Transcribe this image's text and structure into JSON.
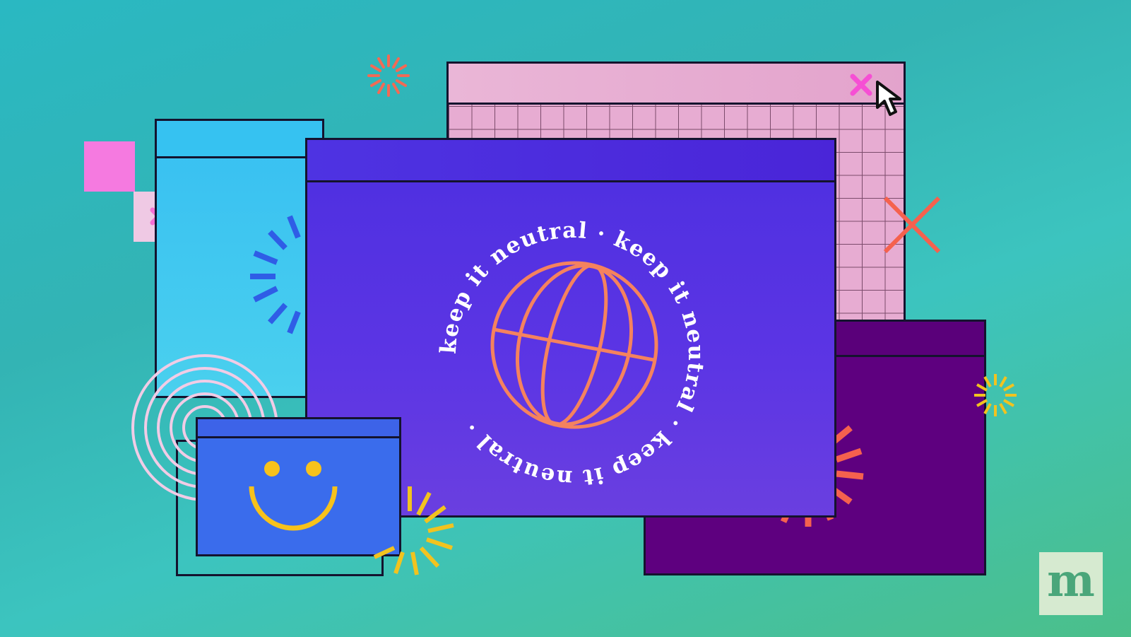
{
  "illustration": {
    "circular_text": "keep it neutral · keep it neutral · keep it neutral · ",
    "logo_letter": "m",
    "icons": [
      "globe-icon",
      "smiley-face-icon",
      "cursor-icon",
      "close-x-icon",
      "sunburst-icon",
      "concentric-circles-icon"
    ],
    "colors": {
      "background_start": "#2ab8c2",
      "background_end": "#4bbf8a",
      "main_window": "#5530e2",
      "globe": "#f5825e",
      "blue_window": "#37bff2",
      "pink_window": "#e7acd2",
      "purple_window": "#5e007f",
      "smiley_window": "#3a6cec",
      "smiley": "#f7c21b",
      "pink_accent": "#f64fd4",
      "coral_x": "#f5614e",
      "yellow_burst": "#f2c31f"
    }
  }
}
